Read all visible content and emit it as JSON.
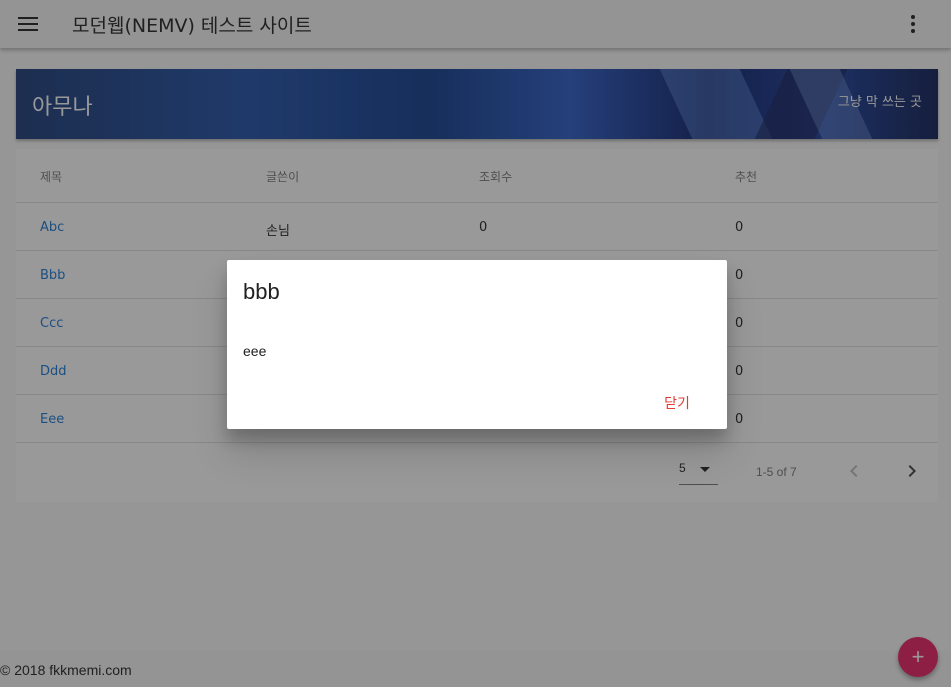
{
  "appbar": {
    "title": "모던웹(NEMV) 테스트 사이트"
  },
  "banner": {
    "title": "아무나",
    "subtitle": "그냥 막 쓰는 곳"
  },
  "table": {
    "headers": [
      "제목",
      "글쓴이",
      "조회수",
      "추천"
    ],
    "rows": [
      [
        "Abc",
        "손님",
        "0",
        "0"
      ],
      [
        "Bbb",
        "",
        "",
        "0"
      ],
      [
        "Ccc",
        "",
        "",
        "0"
      ],
      [
        "Ddd",
        "",
        "",
        "0"
      ],
      [
        "Eee",
        "",
        "",
        "0"
      ]
    ],
    "pagination": {
      "rows_per_page": "5",
      "range": "1-5 of 7"
    }
  },
  "footer": {
    "copyright": "© 2018 fkkmemi.com"
  },
  "fab": {
    "icon": "plus-icon",
    "symbol": "+",
    "color": "#e91e63"
  },
  "dialog": {
    "title": "bbb",
    "body": "eee",
    "close_label": "닫기",
    "close_color": "#e53935"
  }
}
